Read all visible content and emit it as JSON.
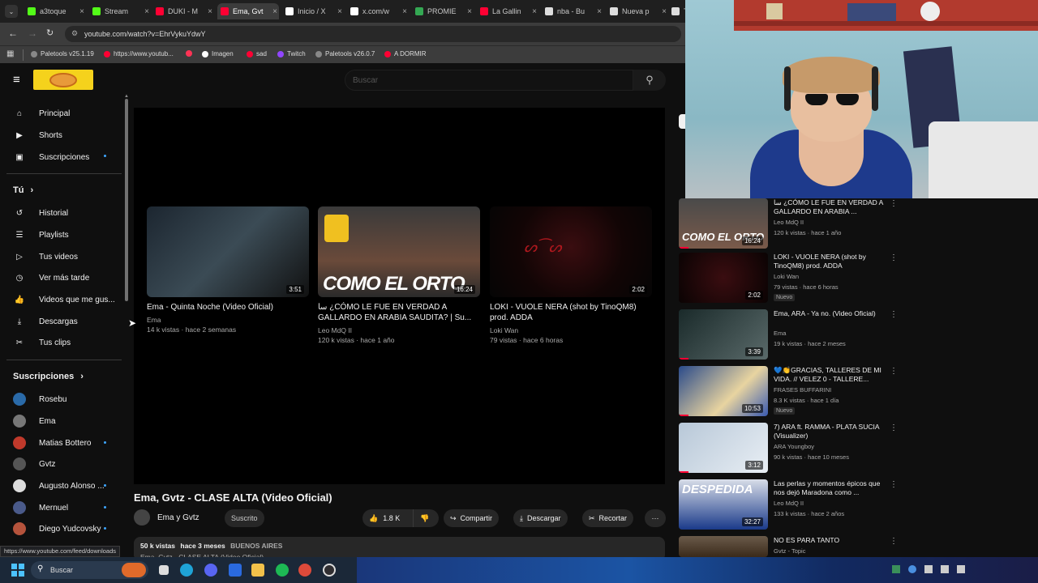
{
  "tabs": [
    {
      "label": "a3toque",
      "color": "#53fc18"
    },
    {
      "label": "Stream",
      "color": "#53fc18"
    },
    {
      "label": "DUKI - M",
      "color": "#ff0033"
    },
    {
      "label": "Ema, Gvt",
      "color": "#ff0033"
    },
    {
      "label": "Inicio / X",
      "color": "#ffffff"
    },
    {
      "label": "x.com/w",
      "color": "#ffffff"
    },
    {
      "label": "PROMIE",
      "color": "#34a853"
    },
    {
      "label": "La Gallin",
      "color": "#ff0033"
    },
    {
      "label": "nba - Bu",
      "color": "#dddddd"
    },
    {
      "label": "Nueva p",
      "color": "#dddddd"
    },
    {
      "label": "T",
      "color": "#dddddd"
    }
  ],
  "address": {
    "url": "youtube.com/watch?v=EhrVykuYdwY"
  },
  "bookmarks": [
    {
      "label": "Paletools v25.1.19",
      "color": "#888888"
    },
    {
      "label": "https://www.youtub...",
      "color": "#ff0033"
    },
    {
      "label": "",
      "color": "#ff3355"
    },
    {
      "label": "Imagen",
      "color": "#ffffff"
    },
    {
      "label": "sad",
      "color": "#ff0033"
    },
    {
      "label": "Twitch",
      "color": "#9146ff"
    },
    {
      "label": "Paletools v26.0.7",
      "color": "#888888"
    },
    {
      "label": "A DORMIR",
      "color": "#ff0033"
    }
  ],
  "search": {
    "placeholder": "Buscar"
  },
  "sidebar": {
    "main": [
      {
        "label": "Principal",
        "icon": "home-icon"
      },
      {
        "label": "Shorts",
        "icon": "shorts-icon"
      },
      {
        "label": "Suscripciones",
        "icon": "subscriptions-icon"
      }
    ],
    "you_heading": "Tú",
    "you": [
      {
        "label": "Historial",
        "icon": "history-icon"
      },
      {
        "label": "Playlists",
        "icon": "playlists-icon"
      },
      {
        "label": "Tus videos",
        "icon": "your-videos-icon"
      },
      {
        "label": "Ver más tarde",
        "icon": "watch-later-icon"
      },
      {
        "label": "Videos que me gus...",
        "icon": "liked-icon"
      },
      {
        "label": "Descargas",
        "icon": "download-icon"
      },
      {
        "label": "Tus clips",
        "icon": "clips-icon"
      }
    ],
    "subs_heading": "Suscripciones",
    "subs": [
      {
        "label": "Rosebu",
        "color": "#2a6aa8",
        "dot": false
      },
      {
        "label": "Ema",
        "color": "#777777",
        "dot": false
      },
      {
        "label": "Matias Bottero",
        "color": "#c0392b",
        "dot": true
      },
      {
        "label": "Gvtz",
        "color": "#555555",
        "dot": false
      },
      {
        "label": "Augusto Alonso ...",
        "color": "#dddddd",
        "dot": true
      },
      {
        "label": "Mernuel",
        "color": "#4a5a8a",
        "dot": true
      },
      {
        "label": "Diego Yudcovsky",
        "color": "#b5533c",
        "dot": true
      }
    ]
  },
  "endscreen": [
    {
      "title": "Ema - Quinta Noche (Video Oficial)",
      "channel": "Ema",
      "meta": "14 k vistas · hace 2 semanas",
      "duration": "3:51",
      "overlay": ""
    },
    {
      "title": "ﺳﺎ ¿CÓMO LE FUE EN VERDAD A GALLARDO EN ARABIA SAUDITA? | Su...",
      "channel": "Leo MdQ II",
      "meta": "120 k vistas · hace 1 año",
      "duration": "16:24",
      "overlay": "COMO EL ORTO"
    },
    {
      "title": "LOKI - VUOLE NERA (shot by TinoQM8) prod. ADDA",
      "channel": "Loki Wan",
      "meta": "79 vistas · hace 6 horas",
      "duration": "2:02",
      "overlay": ""
    }
  ],
  "video": {
    "title": "Ema, Gvtz - CLASE ALTA (Video Oficial)",
    "channel": "Ema y Gvtz",
    "subscribe": "Suscrito",
    "likes": "1.8 K",
    "share": "Compartir",
    "download": "Descargar",
    "clip": "Recortar",
    "more": "···",
    "views": "50 k vistas",
    "date": "hace 3 meses",
    "location": "BUENOS AIRES",
    "desc_peek": "Ema, Gvtz - CLASE ALTA (Video Oficial)"
  },
  "related": [
    {
      "title": "ﺳﺎ ¿CÓMO LE FUE EN VERDAD A GALLARDO EN ARABIA ...",
      "channel": "Leo MdQ II",
      "meta": "120 k vistas · hace 1 año",
      "duration": "16:24",
      "new": "",
      "overlay": "COMO EL ORTO"
    },
    {
      "title": "LOKI - VUOLE NERA (shot by TinoQM8) prod. ADDA",
      "channel": "Loki Wan",
      "meta": "79 vistas · hace 6 horas",
      "duration": "2:02",
      "new": "Nuevo",
      "overlay": ""
    },
    {
      "title": "Ema, ARA - Ya no. (Video Oficial)",
      "channel": "Ema",
      "meta": "19 k vistas · hace 2 meses",
      "duration": "3:39",
      "new": "",
      "overlay": ""
    },
    {
      "title": "💙👏GRACIAS, TALLERES DE MI VIDA. // VELEZ 0 - TALLERE...",
      "channel": "FRASES BUFFARINI",
      "meta": "8.3 K vistas · hace 1 día",
      "duration": "10:53",
      "new": "Nuevo",
      "overlay": ""
    },
    {
      "title": "7) ARA ft. RAMMA - PLATA SUCIA (Visualizer)",
      "channel": "ARA Youngboy",
      "meta": "90 k vistas · hace 10 meses",
      "duration": "3:12",
      "new": "",
      "overlay": ""
    },
    {
      "title": "Las perlas y momentos épicos que nos dejó Maradona como ...",
      "channel": "Leo MdQ II",
      "meta": "133 k vistas · hace 2 años",
      "duration": "32:27",
      "new": "",
      "overlay": "DESPEDIDA"
    },
    {
      "title": "NO ES PARA TANTO",
      "channel": "Gvtz - Topic",
      "meta": "",
      "duration": "",
      "new": "",
      "overlay": ""
    }
  ],
  "status_url": "https://www.youtube.com/feed/downloads",
  "taskbar": {
    "search": "Buscar"
  },
  "colors": {
    "yt_bg": "#0f0f0f",
    "accent_red": "#ff0033",
    "link_blue": "#3ea6ff",
    "chrome_bg": "#3c3c3c"
  }
}
